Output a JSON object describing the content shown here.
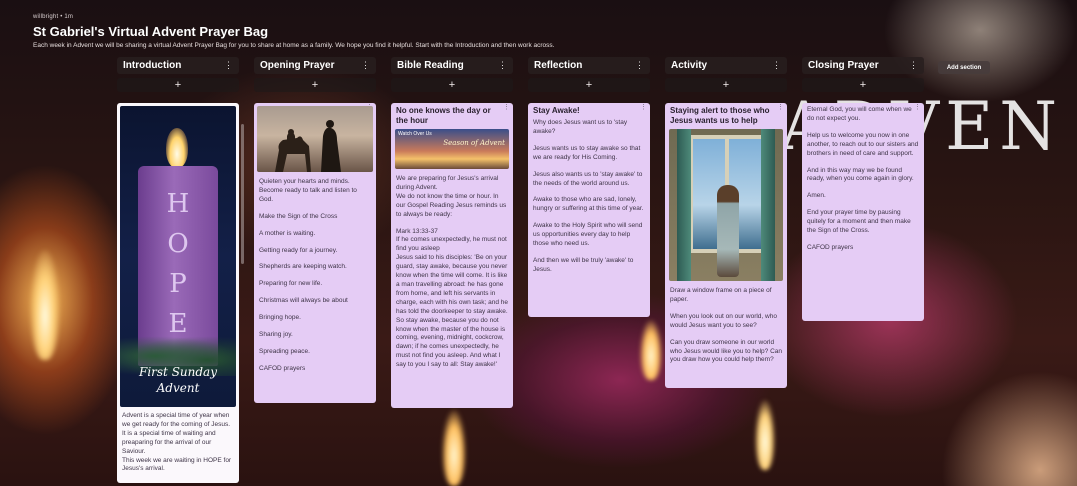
{
  "header": {
    "meta": "willbright • 1m",
    "title": "St Gabriel's Virtual Advent Prayer Bag",
    "description": "Each week in Advent we will be sharing a virtual Advent Prayer Bag for you to share at home as a family. We hope you find it helpful. Start with the Introduction and then work across."
  },
  "background_text": "ADVEN",
  "add_post_symbol": "+",
  "add_section_label": "Add section",
  "columns": [
    {
      "title": "Introduction",
      "card": {
        "image_alt": "purple HOPE candle",
        "image_text": {
          "word": "HOPE",
          "caption_line1": "First Sunday",
          "caption_line2": "Advent"
        },
        "lines": [
          "Advent is a special time of year when we get ready for the coming of Jesus. It is a special time of waiting and preaparing for the arrival of our Saviour.",
          "This week we are waiting in HOPE for Jesus's arrival."
        ]
      }
    },
    {
      "title": "Opening Prayer",
      "card": {
        "image_alt": "silhouettes of Mary and Joseph with a donkey",
        "lines": [
          "Quieten your hearts and minds. Become ready to talk and listen to God.",
          "Make the Sign of the Cross",
          "A mother is waiting.",
          "Getting ready for a journey.",
          "Shepherds are keeping watch.",
          "Preparing for new life.",
          "Christmas will always be about",
          "Bringing hope.",
          "Sharing joy.",
          "Spreading peace.",
          "CAFOD prayers"
        ]
      }
    },
    {
      "title": "Bible Reading",
      "card": {
        "title": "No one knows the day or the hour",
        "image_alt": "Season of Advent sunrise",
        "image_text": {
          "small": "Watch Over Us",
          "banner": "Season of Advent"
        },
        "lines": [
          "We are preparing for Jesus's arrival during Advent.",
          "We do not know the time or hour. In our Gospel Reading Jesus reminds us to always be ready:",
          "Mark 13:33-37",
          "If he comes unexpectedly, he must not find you asleep",
          "Jesus said to his disciples: 'Be on your guard, stay awake, because you never know when the time will come. It is like a man travelling abroad: he has gone from home, and left his servants in charge, each with his own task; and he has told the doorkeeper to stay awake. So stay awake, because you do not know when the master of the house is coming, evening, midnight, cockcrow, dawn; if he comes unexpectedly, he must not find you asleep. And what I say to you I say to all: Stay awake!'"
        ]
      }
    },
    {
      "title": "Reflection",
      "card": {
        "title": "Stay Awake!",
        "subtitle": "Why does Jesus want us to 'stay awake?",
        "lines": [
          "Jesus wants us to stay awake so that we are ready for His Coming.",
          "Jesus also wants us to 'stay awake' to the needs of the world around us.",
          "Awake to those who are sad, lonely, hungry or suffering at this time of year.",
          "Awake to the Holy Spirit who will send us opportunities every day to help those who need us.",
          "And then we will be truly 'awake' to Jesus."
        ]
      }
    },
    {
      "title": "Activity",
      "card": {
        "title": "Staying alert to those who Jesus wants us to help",
        "image_alt": "girl looking out of a window",
        "lines": [
          "Draw a window frame on a piece of paper.",
          "When you look out on our world, who would Jesus want you to see?",
          "Can you draw someone in our world who Jesus would like you to help? Can you draw how you could help them?"
        ]
      }
    },
    {
      "title": "Closing Prayer",
      "card": {
        "lines": [
          "Eternal God, you will come when we do not expect you.",
          "Help us to welcome you now in one another, to reach out to our sisters and brothers in need of care and support.",
          "And in this way may we be found ready, when you come again in glory.",
          "Amen.",
          "End your prayer time by pausing quitely for a moment and then make the Sign of the Cross.",
          "CAFOD prayers"
        ]
      }
    }
  ],
  "icons": {
    "column_menu": "vertical-dots-icon",
    "card_menu": "vertical-dots-icon"
  },
  "colors": {
    "card": "#e5ccf5",
    "column_header": "#2a1e1e",
    "text": "#3e3447"
  }
}
